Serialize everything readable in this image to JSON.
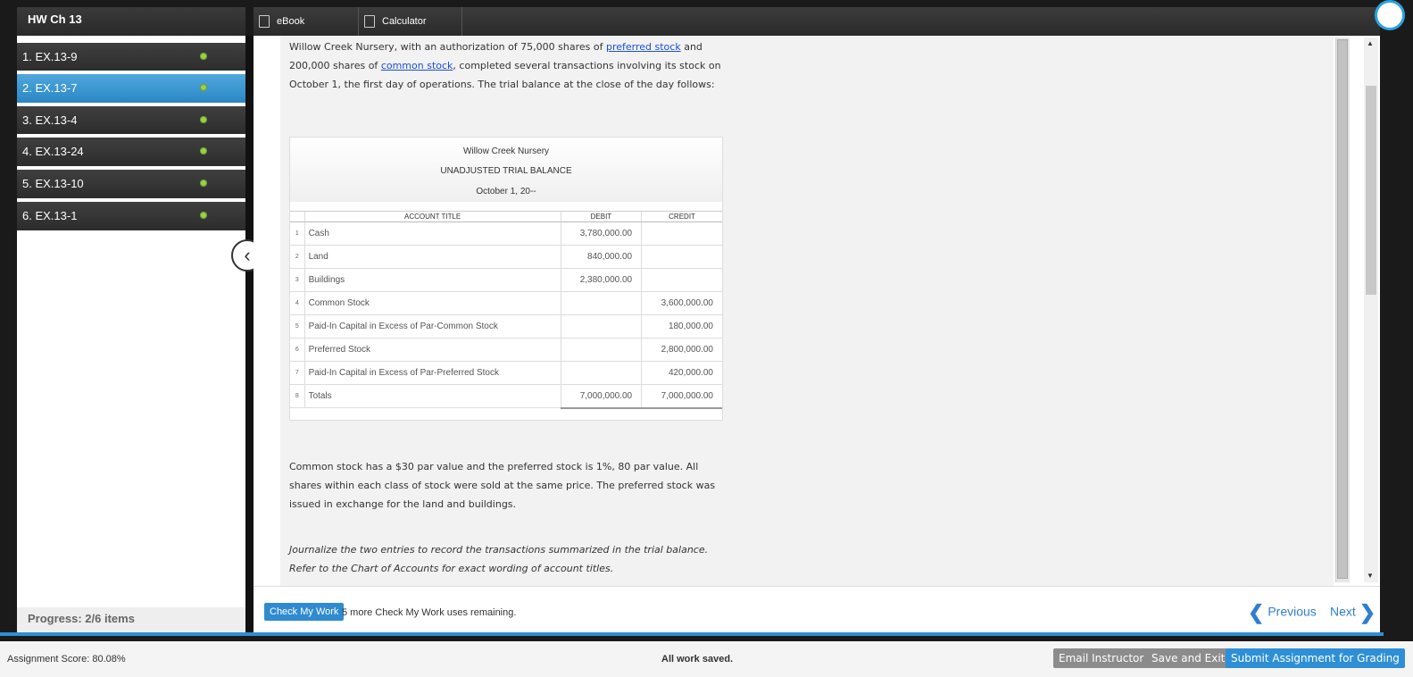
{
  "sidebar": {
    "title": "HW Ch 13",
    "items": [
      {
        "label": "1. EX.13-9"
      },
      {
        "label": "2. EX.13-7"
      },
      {
        "label": "3. EX.13-4"
      },
      {
        "label": "4. EX.13-24"
      },
      {
        "label": "5. EX.13-10"
      },
      {
        "label": "6. EX.13-1"
      }
    ],
    "active_index": 1,
    "progress": "Progress: 2/6 items"
  },
  "toolbar": {
    "ebook_label": "eBook",
    "calculator_label": "Calculator"
  },
  "problem": {
    "intro_part1": "Willow Creek Nursery, with an authorization of 75,000 shares of ",
    "link_preferred": "preferred stock",
    "intro_part2": " and 200,000 shares of ",
    "link_common": "common stock",
    "intro_part3": ", completed several transactions involving its stock on October 1, the first day of operations. The trial balance at the close of the day follows:",
    "details": "Common stock has a $30 par value and the preferred stock is 1%, 80 par value. All shares within each class of stock were sold at the same price. The preferred stock was issued in exchange for the land and buildings.",
    "instruction": "Journalize the two entries to record the transactions summarized in the trial balance. Refer to the Chart of Accounts for exact wording of account titles."
  },
  "trial_balance": {
    "company": "Willow Creek Nursery",
    "title": "UNADJUSTED TRIAL BALANCE",
    "date": "October 1, 20--",
    "headers": {
      "account": "ACCOUNT TITLE",
      "debit": "DEBIT",
      "credit": "CREDIT"
    },
    "rows": [
      {
        "num": "1",
        "account": "Cash",
        "debit": "3,780,000.00",
        "credit": ""
      },
      {
        "num": "2",
        "account": "Land",
        "debit": "840,000.00",
        "credit": ""
      },
      {
        "num": "3",
        "account": "Buildings",
        "debit": "2,380,000.00",
        "credit": ""
      },
      {
        "num": "4",
        "account": "Common Stock",
        "debit": "",
        "credit": "3,600,000.00"
      },
      {
        "num": "5",
        "account": "Paid-In Capital in Excess of Par-Common Stock",
        "debit": "",
        "credit": "180,000.00"
      },
      {
        "num": "6",
        "account": "Preferred Stock",
        "debit": "",
        "credit": "2,800,000.00"
      },
      {
        "num": "7",
        "account": "Paid-In Capital in Excess of Par-Preferred Stock",
        "debit": "",
        "credit": "420,000.00"
      },
      {
        "num": "8",
        "account": "Totals",
        "debit": "7,000,000.00",
        "credit": "7,000,000.00"
      }
    ]
  },
  "footer": {
    "check_label": "Check My Work",
    "check_remaining": "5 more Check My Work uses remaining.",
    "previous_label": "Previous",
    "next_label": "Next"
  },
  "status": {
    "score": "Assignment Score: 80.08%",
    "saved": "All work saved.",
    "email_label": "Email Instructor",
    "save_exit_label": "Save and Exit",
    "submit_label": "Submit Assignment for Grading"
  }
}
